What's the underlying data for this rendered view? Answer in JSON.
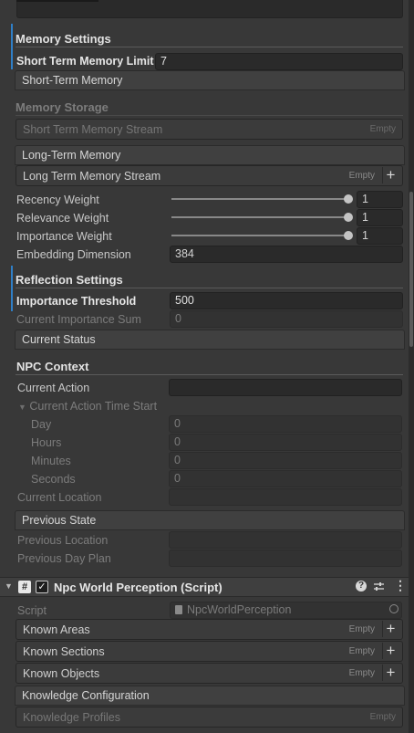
{
  "memory": {
    "header": "Memory Settings",
    "short_term_limit_label": "Short Term Memory Limit",
    "short_term_limit_value": "7",
    "short_term_section": "Short-Term Memory",
    "storage_header": "Memory Storage",
    "short_term_stream_label": "Short Term Memory Stream",
    "empty": "Empty",
    "long_term_section": "Long-Term Memory",
    "long_term_stream_label": "Long Term Memory Stream",
    "sliders": [
      {
        "label": "Recency Weight",
        "value": "1",
        "level": 1.0
      },
      {
        "label": "Relevance Weight",
        "value": "1",
        "level": 1.0
      },
      {
        "label": "Importance Weight",
        "value": "1",
        "level": 1.0
      }
    ],
    "embedding_label": "Embedding Dimension",
    "embedding_value": "384"
  },
  "reflection": {
    "header": "Reflection Settings",
    "threshold_label": "Importance Threshold",
    "threshold_value": "500",
    "sum_label": "Current Importance Sum",
    "sum_value": "0",
    "current_status": "Current Status"
  },
  "npc": {
    "header": "NPC Context",
    "current_action_label": "Current Action",
    "current_action_value": "",
    "time_start_label": "Current Action Time Start",
    "time_fields": [
      {
        "label": "Day",
        "value": "0"
      },
      {
        "label": "Hours",
        "value": "0"
      },
      {
        "label": "Minutes",
        "value": "0"
      },
      {
        "label": "Seconds",
        "value": "0"
      }
    ],
    "location_label": "Current Location",
    "previous_state": "Previous State",
    "prev_location_label": "Previous Location",
    "prev_plan_label": "Previous Day Plan"
  },
  "component": {
    "title": "Npc World Perception (Script)",
    "script_label": "Script",
    "script_value": "NpcWorldPerception",
    "lists": [
      {
        "label": "Known Areas"
      },
      {
        "label": "Known Sections"
      },
      {
        "label": "Known Objects"
      }
    ],
    "knowledge_config": "Knowledge Configuration",
    "knowledge_profiles": "Knowledge Profiles"
  },
  "colors": {
    "accent": "#2f7fc7",
    "background": "#383838"
  }
}
